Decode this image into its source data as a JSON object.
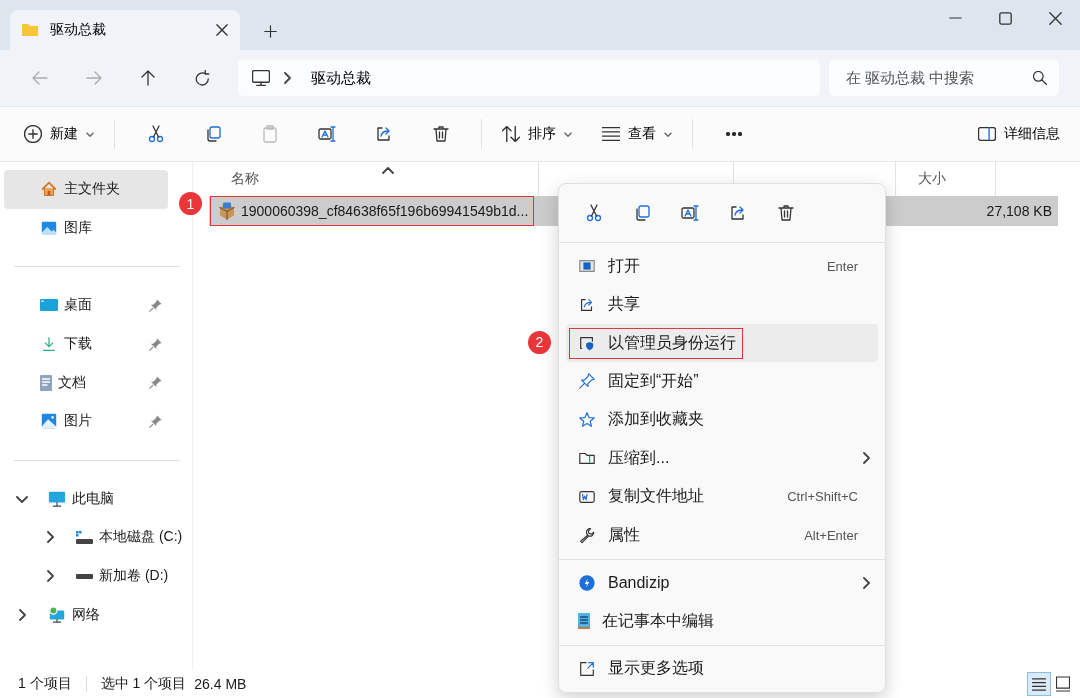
{
  "window": {
    "tab_title": "驱动总裁"
  },
  "address": {
    "crumbs": [
      "驱动总裁"
    ]
  },
  "search": {
    "placeholder": "在 驱动总裁 中搜索"
  },
  "toolbar": {
    "new_label": "新建",
    "sort_label": "排序",
    "view_label": "查看",
    "details_label": "详细信息"
  },
  "sidebar": {
    "sections": [
      [
        {
          "label": "主文件夹",
          "kind": "home",
          "selected": true,
          "pinned": false
        },
        {
          "label": "图库",
          "kind": "gallery",
          "selected": false,
          "pinned": false
        }
      ],
      [
        {
          "label": "桌面",
          "kind": "desktop",
          "selected": false,
          "pinned": true
        },
        {
          "label": "下载",
          "kind": "download",
          "selected": false,
          "pinned": true
        },
        {
          "label": "文档",
          "kind": "docs",
          "selected": false,
          "pinned": true
        },
        {
          "label": "图片",
          "kind": "pictures",
          "selected": false,
          "pinned": true
        }
      ]
    ],
    "tree": [
      {
        "label": "此电脑",
        "kind": "pc",
        "expanded": true,
        "children": [
          {
            "label": "本地磁盘 (C:)",
            "kind": "system-drive",
            "expanded": false
          },
          {
            "label": "新加卷 (D:)",
            "kind": "drive",
            "expanded": false
          }
        ]
      },
      {
        "label": "网络",
        "kind": "network",
        "expanded": false
      }
    ]
  },
  "table": {
    "columns": [
      {
        "label": "名称",
        "sorted": true
      },
      {
        "label": "大小",
        "sorted": false
      }
    ],
    "rows": [
      {
        "name": "1900060398_cf84638f65f196b69941549b1d...",
        "size": "27,108 KB",
        "selected": true,
        "outlined": true,
        "callout": "1"
      }
    ]
  },
  "context_menu": {
    "groups": [
      [
        {
          "label": "打开",
          "kind": "open",
          "shortcut": "Enter",
          "submenu": false,
          "hovered": false,
          "outlined": false
        },
        {
          "label": "共享",
          "kind": "share",
          "submenu": false,
          "hovered": false,
          "outlined": false
        },
        {
          "label": "以管理员身份运行",
          "kind": "admin",
          "submenu": false,
          "hovered": true,
          "outlined": true,
          "callout": "2"
        },
        {
          "label": "固定到“开始”",
          "kind": "pin",
          "submenu": false,
          "hovered": false,
          "outlined": false
        },
        {
          "label": "添加到收藏夹",
          "kind": "star",
          "submenu": false,
          "hovered": false,
          "outlined": false
        },
        {
          "label": "压缩到...",
          "kind": "zip",
          "submenu": true,
          "hovered": false,
          "outlined": false
        },
        {
          "label": "复制文件地址",
          "kind": "path",
          "shortcut": "Ctrl+Shift+C",
          "submenu": false,
          "hovered": false,
          "outlined": false
        },
        {
          "label": "属性",
          "kind": "wrench",
          "shortcut": "Alt+Enter",
          "submenu": false,
          "hovered": false,
          "outlined": false
        }
      ],
      [
        {
          "label": "Bandizip",
          "kind": "bandizip",
          "submenu": true,
          "hovered": false,
          "outlined": false
        },
        {
          "label": "在记事本中编辑",
          "kind": "notepad",
          "submenu": false,
          "hovered": false,
          "outlined": false
        }
      ],
      [
        {
          "label": "显示更多选项",
          "kind": "more",
          "submenu": false,
          "hovered": false,
          "outlined": false
        }
      ]
    ]
  },
  "status_bar": {
    "count": "1 个项目",
    "selection": "选中 1 个项目",
    "size": "26.4 MB",
    "views": [
      {
        "kind": "details",
        "selected": true
      },
      {
        "kind": "tiles",
        "selected": false
      }
    ]
  }
}
